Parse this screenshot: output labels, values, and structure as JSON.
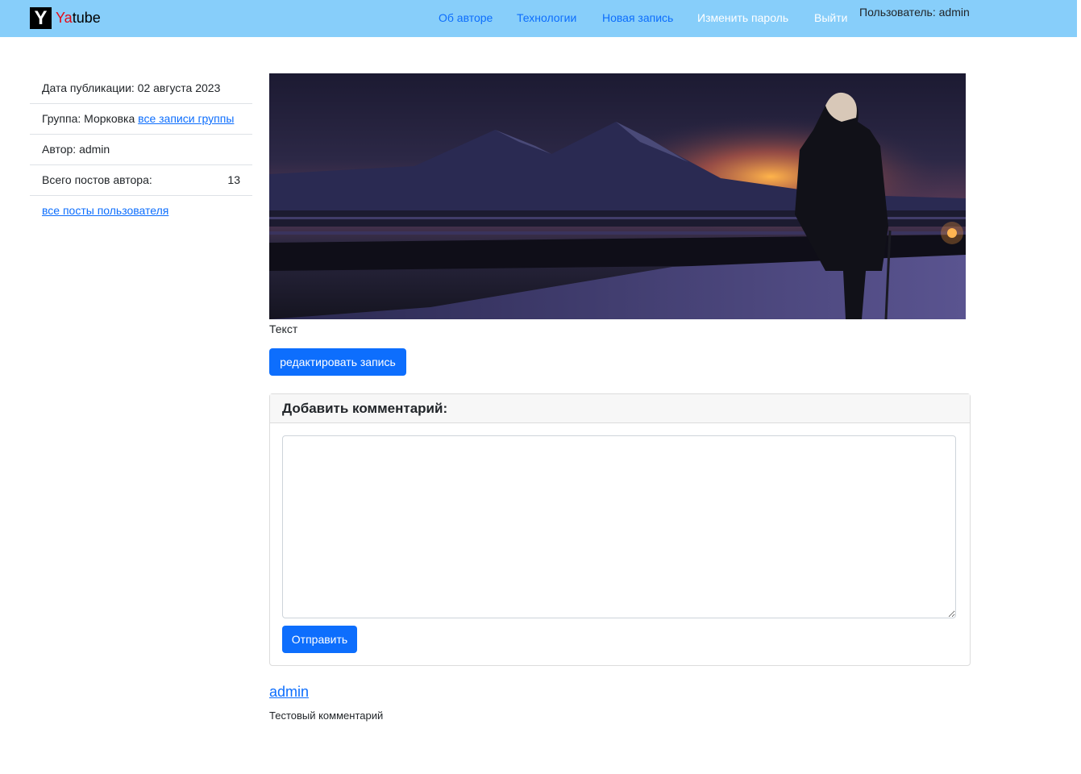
{
  "brand": {
    "logo_letter": "Y",
    "name_accent": "Ya",
    "name_rest": "tube"
  },
  "nav": {
    "about": "Об авторе",
    "tech": "Технологии",
    "new_post": "Новая запись",
    "change_password": "Изменить пароль",
    "logout": "Выйти",
    "user": "Пользователь: admin"
  },
  "sidebar": {
    "pub_date": "Дата публикации: 02 августа 2023",
    "group_prefix": "Группа: Морковка ",
    "group_link": "все записи группы",
    "author": "Автор: admin",
    "posts_label": "Всего постов автора:",
    "posts_count": "13",
    "user_posts_link": "все посты пользователя"
  },
  "post": {
    "text": "Текст",
    "edit_label": "редактировать запись"
  },
  "comment_form": {
    "title": "Добавить комментарий:",
    "textarea_value": "",
    "submit_label": "Отправить"
  },
  "comments": [
    {
      "author": "admin",
      "text": "Тестовый комментарий"
    }
  ],
  "colors": {
    "navbar": "#87cefa",
    "primary": "#0d6efd",
    "brand_accent": "#e30b17"
  }
}
